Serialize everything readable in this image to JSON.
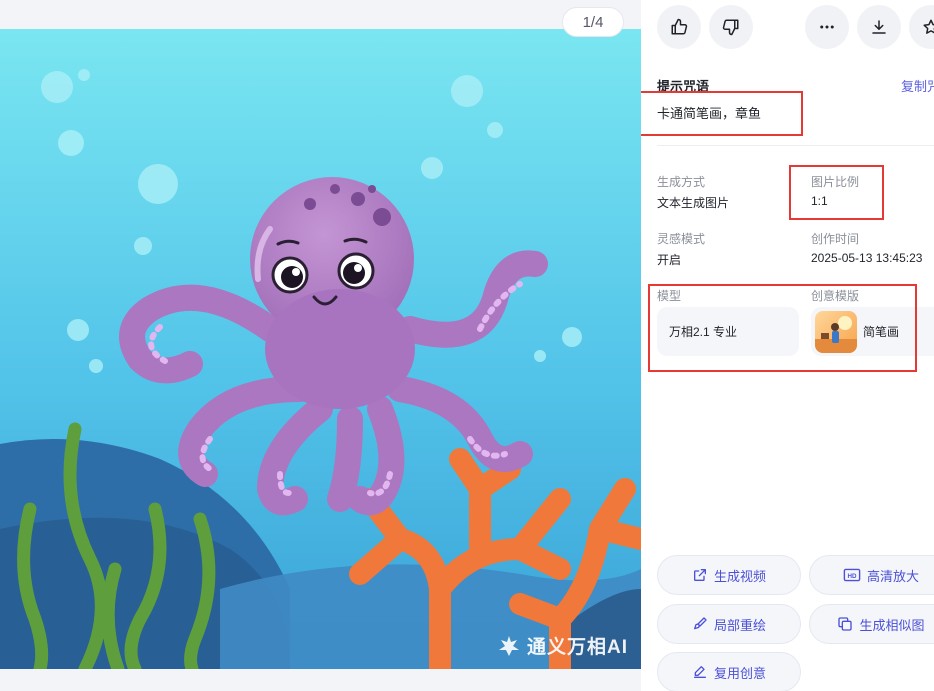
{
  "viewer": {
    "counter": "1/4",
    "watermark": "通义万相AI"
  },
  "toolbar": {
    "icons": [
      "thumbs-up-icon",
      "thumbs-down-icon",
      "more-icon",
      "download-icon",
      "star-icon"
    ]
  },
  "prompt": {
    "title": "提示咒语",
    "copy_label": "复制咒",
    "text": "卡通简笔画，章鱼"
  },
  "meta": {
    "gen_method_label": "生成方式",
    "gen_method_value": "文本生成图片",
    "ratio_label": "图片比例",
    "ratio_value": "1:1",
    "inspiration_label": "灵感模式",
    "inspiration_value": "开启",
    "created_label": "创作时间",
    "created_value": "2025-05-13 13:45:23",
    "model_label": "模型",
    "model_value": "万相2.1 专业",
    "template_label": "创意模版",
    "template_value": "简笔画"
  },
  "actions": {
    "gen_video": "生成视频",
    "hd_upscale": "高清放大",
    "local_repaint": "局部重绘",
    "gen_similar": "生成相似图",
    "reuse": "复用创意"
  },
  "colors": {
    "accent": "#4b50d6",
    "annotation": "#e53935",
    "octopus": "#b07fc4",
    "sea_top": "#78e3ef",
    "sea_bottom": "#3aa7d9",
    "coral": "#f07535"
  }
}
